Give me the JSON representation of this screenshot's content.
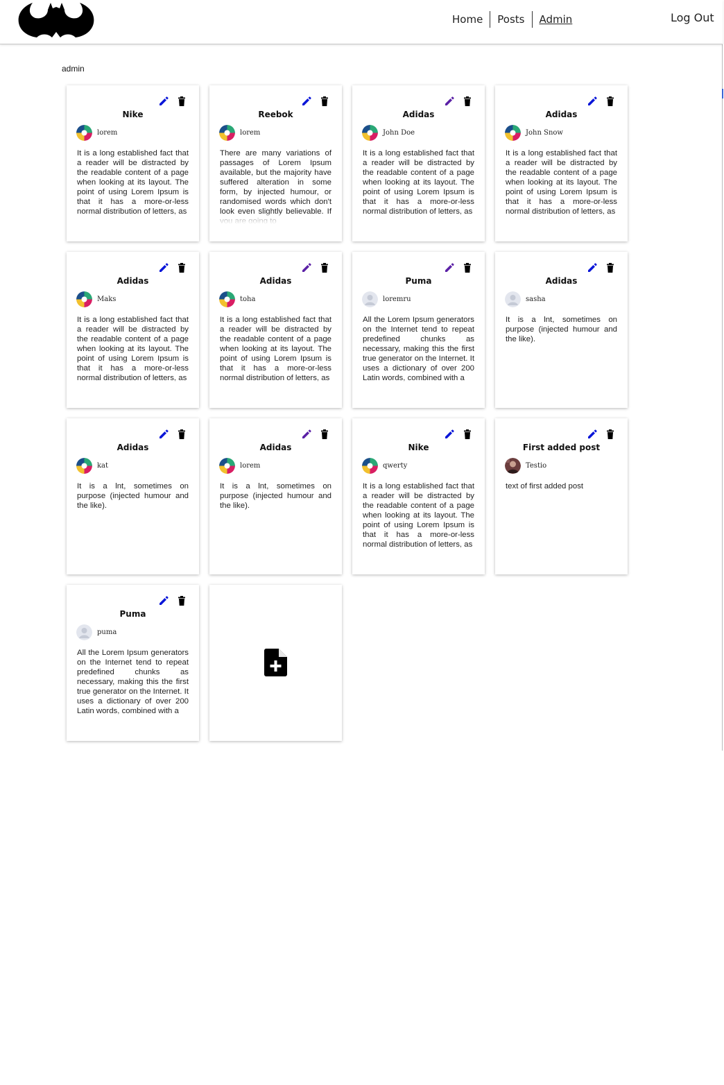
{
  "nav": {
    "links": [
      {
        "label": "Home",
        "active": false
      },
      {
        "label": "Posts",
        "active": false
      },
      {
        "label": "Admin",
        "active": true
      }
    ],
    "logout_label": "Log Out"
  },
  "page_label": "admin",
  "colors": {
    "edit_blue": "#0a16d8",
    "edit_purple": "#5b21a6",
    "delete": "#000000"
  },
  "posts": [
    {
      "title": "Nike",
      "author": "lorem",
      "avatar": "colorful",
      "edit_color": "blue",
      "text": "It is a long established fact that a reader will be distracted by the readable content of a page when looking at its layout. The point of using Lorem Ipsum is that it has a more-or-less normal distribution of letters, as"
    },
    {
      "title": "Reebok",
      "author": "lorem",
      "avatar": "colorful",
      "edit_color": "blue",
      "text": "There are many variations of passages of Lorem Ipsum available, but the majority have suffered alteration in some form, by injected humour, or randomised words which don't look even slightly believable. If you are going to"
    },
    {
      "title": "Adidas",
      "author": "John Doe",
      "avatar": "colorful",
      "edit_color": "purple",
      "text": "It is a long established fact that a reader will be distracted by the readable content of a page when looking at its layout. The point of using Lorem Ipsum is that it has a more-or-less normal distribution of letters, as"
    },
    {
      "title": "Adidas",
      "author": "John Snow",
      "avatar": "colorful",
      "edit_color": "blue",
      "text": "It is a long established fact that a reader will be distracted by the readable content of a page when looking at its layout. The point of using Lorem Ipsum is that it has a more-or-less normal distribution of letters, as"
    },
    {
      "title": "Adidas",
      "author": "Maks",
      "avatar": "colorful",
      "edit_color": "blue",
      "text": "It is a long established fact that a reader will be distracted by the readable content of a page when looking at its layout. The point of using Lorem Ipsum is that it has a more-or-less normal distribution of letters, as"
    },
    {
      "title": "Adidas",
      "author": "toha",
      "avatar": "colorful",
      "edit_color": "purple",
      "text": "It is a long established fact that a reader will be distracted by the readable content of a page when looking at its layout. The point of using Lorem Ipsum is that it has a more-or-less normal distribution of letters, as"
    },
    {
      "title": "Puma",
      "author": "loremru",
      "avatar": "default",
      "edit_color": "purple",
      "text": "All the Lorem Ipsum generators on the Internet tend to repeat predefined chunks as necessary, making this the first true generator on the Internet. It uses a dictionary of over 200 Latin words, combined with a"
    },
    {
      "title": "Adidas",
      "author": "sasha",
      "avatar": "default",
      "edit_color": "blue",
      "text": "It is a lnt, sometimes on purpose (injected humour and the like)."
    },
    {
      "title": "Adidas",
      "author": "kat",
      "avatar": "colorful",
      "edit_color": "blue",
      "text": "It is a lnt, sometimes on purpose (injected humour and the like)."
    },
    {
      "title": "Adidas",
      "author": "lorem",
      "avatar": "colorful",
      "edit_color": "purple",
      "text": "It is a lnt, sometimes on purpose (injected humour and the like)."
    },
    {
      "title": "Nike",
      "author": "qwerty",
      "avatar": "colorful",
      "edit_color": "blue",
      "text": "It is a long established fact that a reader will be distracted by the readable content of a page when looking at its layout. The point of using Lorem Ipsum is that it has a more-or-less normal distribution of letters, as"
    },
    {
      "title": "First added post",
      "author": "Testio",
      "avatar": "photo",
      "edit_color": "blue",
      "text": "text of first added post"
    },
    {
      "title": "Puma",
      "author": "puma",
      "avatar": "default",
      "edit_color": "blue",
      "text": "All the Lorem Ipsum generators on the Internet tend to repeat predefined chunks as necessary, making this the first true generator on the Internet. It uses a dictionary of over 200 Latin words, combined with a"
    }
  ],
  "add_card": {
    "icon": "add-file-icon"
  }
}
